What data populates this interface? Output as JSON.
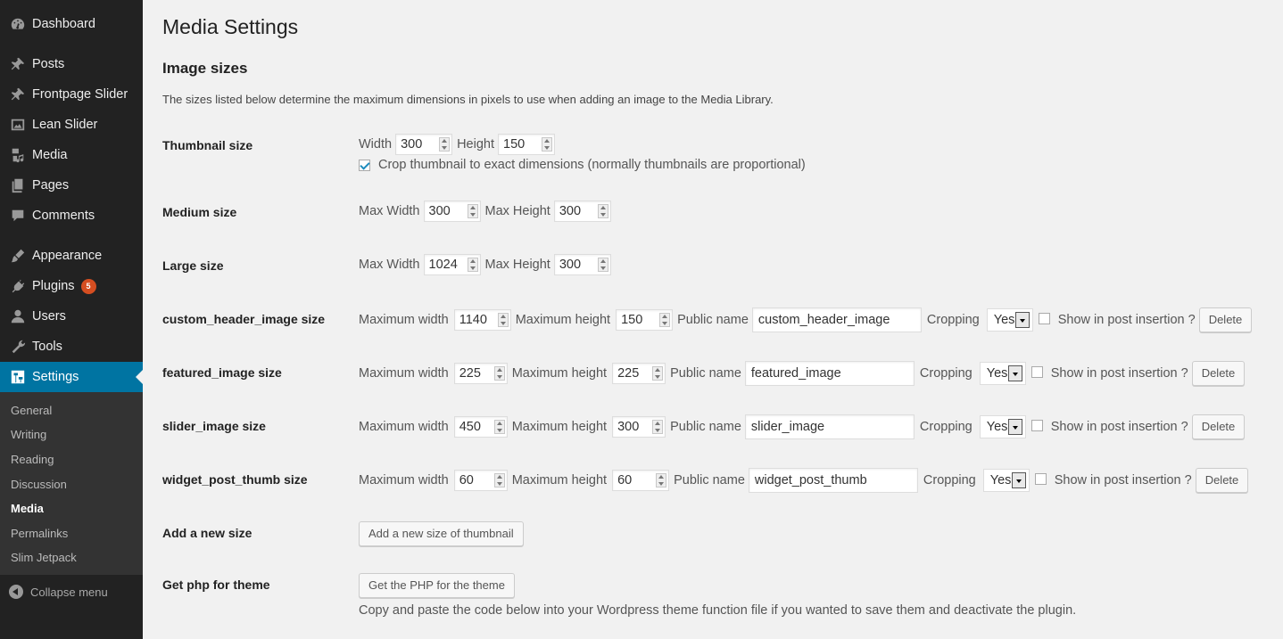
{
  "sidebar": {
    "items": [
      {
        "label": "Dashboard",
        "icon": "dashboard-icon"
      },
      {
        "label": "Posts",
        "icon": "pin-icon"
      },
      {
        "label": "Frontpage Slider",
        "icon": "pin-icon"
      },
      {
        "label": "Lean Slider",
        "icon": "image-icon"
      },
      {
        "label": "Media",
        "icon": "media-icon"
      },
      {
        "label": "Pages",
        "icon": "pages-icon"
      },
      {
        "label": "Comments",
        "icon": "comment-icon"
      },
      {
        "label": "Appearance",
        "icon": "brush-icon"
      },
      {
        "label": "Plugins",
        "icon": "plug-icon",
        "badge": "5"
      },
      {
        "label": "Users",
        "icon": "user-icon"
      },
      {
        "label": "Tools",
        "icon": "wrench-icon"
      },
      {
        "label": "Settings",
        "icon": "settings-icon"
      }
    ],
    "submenu": [
      "General",
      "Writing",
      "Reading",
      "Discussion",
      "Media",
      "Permalinks",
      "Slim Jetpack"
    ],
    "collapse_label": "Collapse menu"
  },
  "page": {
    "title": "Media Settings",
    "section_title": "Image sizes",
    "intro": "The sizes listed below determine the maximum dimensions in pixels to use when adding an image to the Media Library."
  },
  "thumbnail": {
    "label": "Thumbnail size",
    "width_label": "Width",
    "width": "300",
    "height_label": "Height",
    "height": "150",
    "crop_label": "Crop thumbnail to exact dimensions (normally thumbnails are proportional)"
  },
  "medium": {
    "label": "Medium size",
    "w_label": "Max Width",
    "w": "300",
    "h_label": "Max Height",
    "h": "300"
  },
  "large": {
    "label": "Large size",
    "w_label": "Max Width",
    "w": "1024",
    "h_label": "Max Height",
    "h": "300"
  },
  "custom_sizes": [
    {
      "label": "custom_header_image size",
      "w": "1140",
      "h": "150",
      "name": "custom_header_image",
      "crop": "Yes"
    },
    {
      "label": "featured_image size",
      "w": "225",
      "h": "225",
      "name": "featured_image",
      "crop": "Yes"
    },
    {
      "label": "slider_image size",
      "w": "450",
      "h": "300",
      "name": "slider_image",
      "crop": "Yes"
    },
    {
      "label": "widget_post_thumb size",
      "w": "60",
      "h": "60",
      "name": "widget_post_thumb",
      "crop": "Yes"
    }
  ],
  "custom_labels": {
    "max_w": "Maximum width",
    "max_h": "Maximum height",
    "public_name": "Public name",
    "cropping": "Cropping",
    "show": "Show in post insertion ?",
    "delete": "Delete"
  },
  "add_new": {
    "label": "Add a new size",
    "button": "Add a new size of thumbnail"
  },
  "get_php": {
    "label": "Get php for theme",
    "button": "Get the PHP for the theme",
    "help": "Copy and paste the code below into your Wordpress theme function file if you wanted to save them and deactivate the plugin."
  }
}
